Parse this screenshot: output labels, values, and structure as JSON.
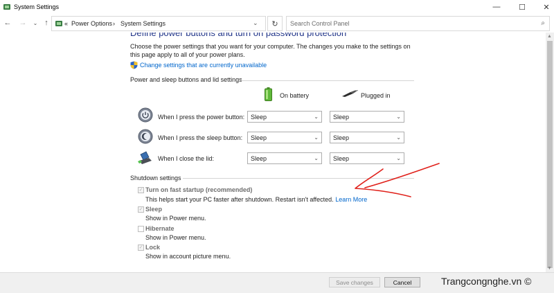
{
  "window": {
    "title": "System Settings"
  },
  "nav": {
    "breadcrumb": [
      "«",
      "Power Options",
      "›",
      "System Settings"
    ],
    "search_placeholder": "Search Control Panel"
  },
  "main": {
    "heading": "Define power buttons and turn on password protection",
    "intro": "Choose the power settings that you want for your computer. The changes you make to the settings on this page apply to all of your power plans.",
    "change_link": "Change settings that are currently unavailable",
    "power_section": {
      "title": "Power and sleep buttons and lid settings",
      "col_battery": "On battery",
      "col_plugged": "Plugged in",
      "rows": [
        {
          "label": "When I press the power button:",
          "battery": "Sleep",
          "plugged": "Sleep",
          "icon": "power-button-icon"
        },
        {
          "label": "When I press the sleep button:",
          "battery": "Sleep",
          "plugged": "Sleep",
          "icon": "sleep-button-icon"
        },
        {
          "label": "When I close the lid:",
          "battery": "Sleep",
          "plugged": "Sleep",
          "icon": "laptop-lid-icon"
        }
      ]
    },
    "shutdown_section": {
      "title": "Shutdown settings",
      "items": [
        {
          "label": "Turn on fast startup (recommended)",
          "desc": "This helps start your PC faster after shutdown. Restart isn't affected.",
          "checked": true,
          "link": "Learn More"
        },
        {
          "label": "Sleep",
          "desc": "Show in Power menu.",
          "checked": true
        },
        {
          "label": "Hibernate",
          "desc": "Show in Power menu.",
          "checked": false
        },
        {
          "label": "Lock",
          "desc": "Show in account picture menu.",
          "checked": true
        }
      ]
    }
  },
  "footer": {
    "save_label": "Save changes",
    "cancel_label": "Cancel",
    "watermark": "Trangcongnghe.vn ©"
  },
  "colors": {
    "link": "#0066cc",
    "heading": "#1e3287",
    "annotation": "#e0201a"
  }
}
